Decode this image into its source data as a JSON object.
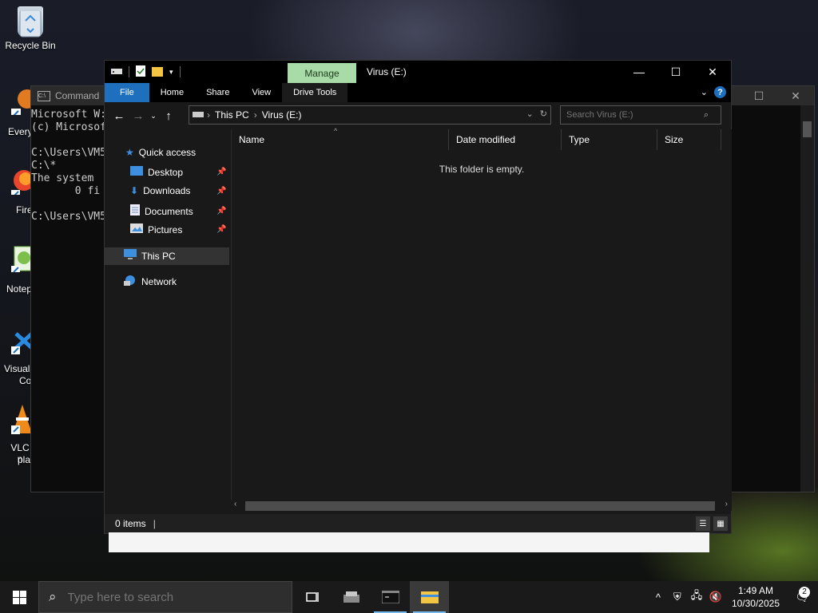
{
  "desktop": {
    "icons": [
      {
        "label": "Recycle Bin"
      },
      {
        "label": "Every"
      },
      {
        "label": "Fire"
      },
      {
        "label": "Notep"
      },
      {
        "label": "Visual"
      },
      {
        "label": "Co"
      },
      {
        "label": "VLC n"
      },
      {
        "label": "pla"
      }
    ]
  },
  "cmd": {
    "title": "Command",
    "lines": [
      "Microsoft W:",
      "(c) Microsof",
      "",
      "C:\\Users\\VM5",
      "C:\\*",
      "The system ",
      "       0 fi",
      "",
      "C:\\Users\\VM5"
    ]
  },
  "explorer": {
    "title": "Virus (E:)",
    "manage_tab": "Manage",
    "ribbon_tabs": [
      "File",
      "Home",
      "Share",
      "View",
      "Drive Tools"
    ],
    "address": {
      "segments": [
        "This PC",
        "Virus (E:)"
      ]
    },
    "search_placeholder": "Search Virus (E:)",
    "nav": {
      "quick_access": "Quick access",
      "pinned": [
        "Desktop",
        "Downloads",
        "Documents",
        "Pictures"
      ],
      "this_pc": "This PC",
      "network": "Network"
    },
    "columns": [
      "Name",
      "Date modified",
      "Type",
      "Size"
    ],
    "empty_message": "This folder is empty.",
    "status": "0 items"
  },
  "taskbar": {
    "search_placeholder": "Type here to search",
    "time": "1:49 AM",
    "date": "10/30/2025",
    "notification_count": "2"
  },
  "colors": {
    "file_tab": "#1f6fbf",
    "manage_tab": "#a8dba8",
    "accent": "#76b9ed"
  }
}
